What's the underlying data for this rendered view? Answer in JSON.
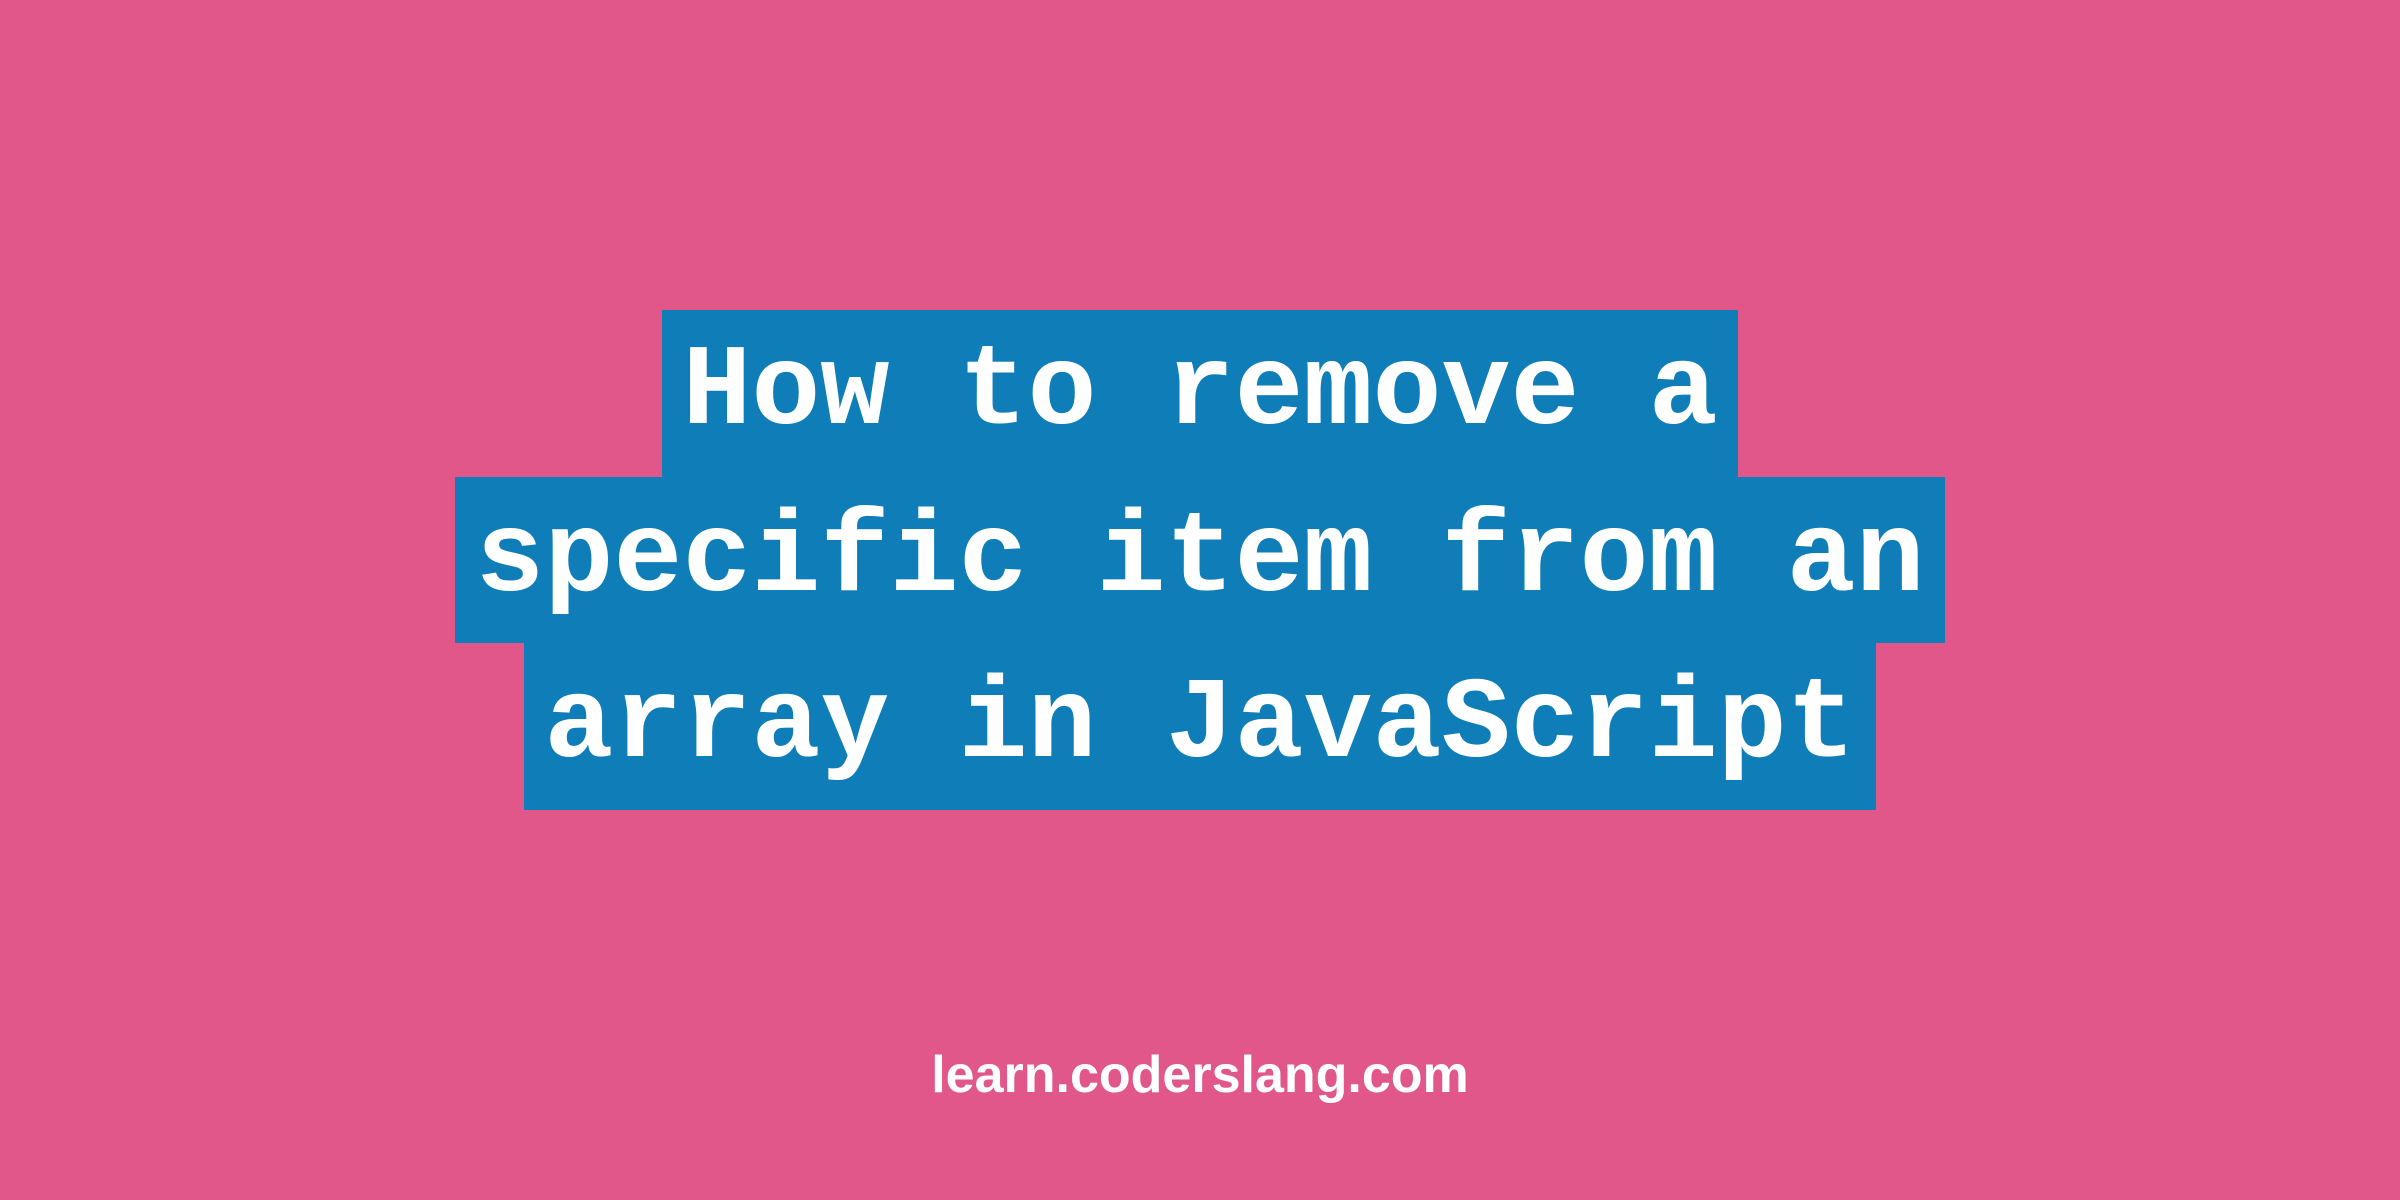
{
  "title": {
    "line1": "How to remove a",
    "line2": "specific item from an",
    "line3": "array in JavaScript"
  },
  "site_url": "learn.coderslang.com",
  "colors": {
    "background": "#e2578a",
    "highlight": "#0e7db8",
    "text": "#ffffff"
  }
}
